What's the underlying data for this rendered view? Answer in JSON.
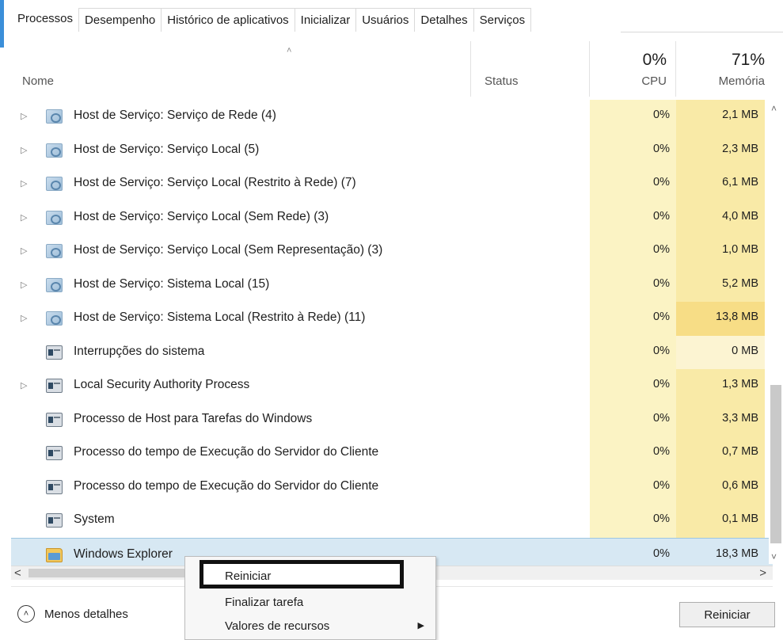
{
  "tabs": [
    {
      "label": "Processos",
      "active": true
    },
    {
      "label": "Desempenho",
      "active": false
    },
    {
      "label": "Histórico de aplicativos",
      "active": false
    },
    {
      "label": "Inicializar",
      "active": false
    },
    {
      "label": "Usuários",
      "active": false
    },
    {
      "label": "Detalhes",
      "active": false
    },
    {
      "label": "Serviços",
      "active": false
    }
  ],
  "header": {
    "name": "Nome",
    "status": "Status",
    "cpu_pct": "0%",
    "cpu": "CPU",
    "mem_pct": "71%",
    "mem": "Memória",
    "sort_glyph": "˄"
  },
  "rows": [
    {
      "name": "Host de Serviço: Serviço de Rede (4)",
      "cpu": "0%",
      "mem": "2,1 MB",
      "icon": "gear-icon",
      "expandable": true,
      "heat": "normal"
    },
    {
      "name": "Host de Serviço: Serviço Local (5)",
      "cpu": "0%",
      "mem": "2,3 MB",
      "icon": "gear-icon",
      "expandable": true,
      "heat": "normal"
    },
    {
      "name": "Host de Serviço: Serviço Local (Restrito à Rede) (7)",
      "cpu": "0%",
      "mem": "6,1 MB",
      "icon": "gear-icon",
      "expandable": true,
      "heat": "normal"
    },
    {
      "name": "Host de Serviço: Serviço Local (Sem Rede) (3)",
      "cpu": "0%",
      "mem": "4,0 MB",
      "icon": "gear-icon",
      "expandable": true,
      "heat": "normal"
    },
    {
      "name": "Host de Serviço: Serviço Local (Sem Representação) (3)",
      "cpu": "0%",
      "mem": "1,0 MB",
      "icon": "gear-icon",
      "expandable": true,
      "heat": "normal"
    },
    {
      "name": "Host de Serviço: Sistema Local (15)",
      "cpu": "0%",
      "mem": "5,2 MB",
      "icon": "gear-icon",
      "expandable": true,
      "heat": "normal"
    },
    {
      "name": "Host de Serviço: Sistema Local (Restrito à Rede) (11)",
      "cpu": "0%",
      "mem": "13,8 MB",
      "icon": "gear-icon",
      "expandable": true,
      "heat": "high"
    },
    {
      "name": "Interrupções do sistema",
      "cpu": "0%",
      "mem": "0 MB",
      "icon": "window-icon",
      "expandable": false,
      "heat": "low"
    },
    {
      "name": "Local Security Authority Process",
      "cpu": "0%",
      "mem": "1,3 MB",
      "icon": "window-icon",
      "expandable": true,
      "heat": "normal"
    },
    {
      "name": "Processo de Host para Tarefas do Windows",
      "cpu": "0%",
      "mem": "3,3 MB",
      "icon": "window-icon",
      "expandable": false,
      "heat": "normal"
    },
    {
      "name": "Processo do tempo de Execução do Servidor do Cliente",
      "cpu": "0%",
      "mem": "0,7 MB",
      "icon": "window-icon",
      "expandable": false,
      "heat": "normal"
    },
    {
      "name": "Processo do tempo de Execução do Servidor do Cliente",
      "cpu": "0%",
      "mem": "0,6 MB",
      "icon": "window-icon",
      "expandable": false,
      "heat": "normal"
    },
    {
      "name": "System",
      "cpu": "0%",
      "mem": "0,1 MB",
      "icon": "window-icon",
      "expandable": false,
      "heat": "normal"
    },
    {
      "name": "Windows Explorer",
      "cpu": "0%",
      "mem": "18,3 MB",
      "icon": "folder-icon",
      "expandable": false,
      "heat": "normal",
      "selected": true
    }
  ],
  "context_menu": {
    "items": [
      {
        "label": "Reiniciar",
        "highlighted": true
      },
      {
        "label": "Finalizar tarefa"
      },
      {
        "label": "Valores de recursos",
        "submenu": true
      }
    ]
  },
  "footer": {
    "fewer_details": "Menos detalhes",
    "restart_button": "Reiniciar"
  },
  "glyphs": {
    "expander": "▷",
    "scroll_up": "˄",
    "scroll_down": "˅",
    "scroll_left": "<",
    "scroll_right": ">",
    "submenu": "▶",
    "circle_up": "˄"
  }
}
